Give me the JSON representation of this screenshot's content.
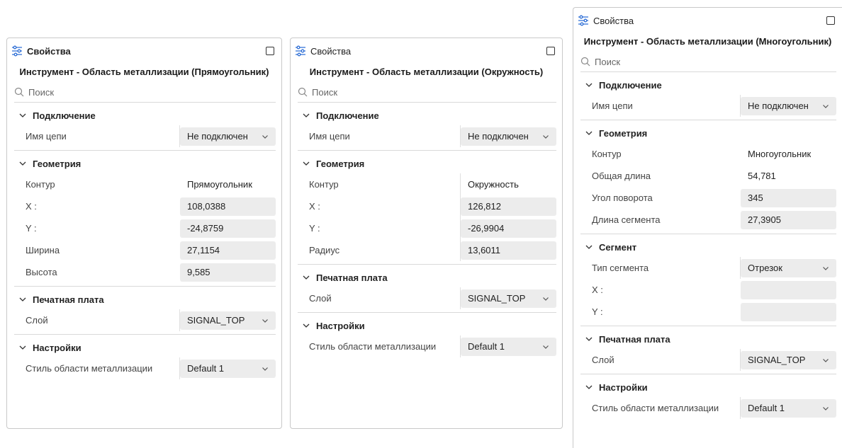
{
  "panels": {
    "rect": {
      "header_title": "Свойства",
      "tool_title": "Инструмент - Область металлизации (Прямоугольник)",
      "search_placeholder": "Поиск",
      "connection": {
        "title": "Подключение",
        "net_label": "Имя цепи",
        "net_value": "Не подключен"
      },
      "geometry": {
        "title": "Геометрия",
        "contour_label": "Контур",
        "contour_value": "Прямоугольник",
        "x_label": "X :",
        "x_value": "108,0388",
        "y_label": "Y :",
        "y_value": "-24,8759",
        "width_label": "Ширина",
        "width_value": "27,1154",
        "height_label": "Высота",
        "height_value": "9,585"
      },
      "pcb": {
        "title": "Печатная плата",
        "layer_label": "Слой",
        "layer_value": "SIGNAL_TOP"
      },
      "settings": {
        "title": "Настройки",
        "style_label": "Стиль области металлизации",
        "style_value": "Default 1"
      }
    },
    "circle": {
      "header_title": "Свойства",
      "tool_title": "Инструмент - Область металлизации (Окружность)",
      "search_placeholder": "Поиск",
      "connection": {
        "title": "Подключение",
        "net_label": "Имя цепи",
        "net_value": "Не подключен"
      },
      "geometry": {
        "title": "Геометрия",
        "contour_label": "Контур",
        "contour_value": "Окружность",
        "x_label": "X :",
        "x_value": "126,812",
        "y_label": "Y :",
        "y_value": "-26,9904",
        "radius_label": "Радиус",
        "radius_value": "13,6011"
      },
      "pcb": {
        "title": "Печатная плата",
        "layer_label": "Слой",
        "layer_value": "SIGNAL_TOP"
      },
      "settings": {
        "title": "Настройки",
        "style_label": "Стиль области металлизации",
        "style_value": "Default 1"
      }
    },
    "poly": {
      "header_title": "Свойства",
      "tool_title": "Инструмент - Область металлизации (Многоугольник)",
      "search_placeholder": "Поиск",
      "connection": {
        "title": "Подключение",
        "net_label": "Имя цепи",
        "net_value": "Не подключен"
      },
      "geometry": {
        "title": "Геометрия",
        "contour_label": "Контур",
        "contour_value": "Многоугольник",
        "total_length_label": "Общая длина",
        "total_length_value": "54,781",
        "rotation_label": "Угол поворота",
        "rotation_value": "345",
        "segment_length_label": "Длина сегмента",
        "segment_length_value": "27,3905"
      },
      "segment": {
        "title": "Сегмент",
        "type_label": "Тип сегмента",
        "type_value": "Отрезок",
        "x_label": "X :",
        "x_value": "",
        "y_label": "Y :",
        "y_value": ""
      },
      "pcb": {
        "title": "Печатная плата",
        "layer_label": "Слой",
        "layer_value": "SIGNAL_TOP"
      },
      "settings": {
        "title": "Настройки",
        "style_label": "Стиль области металлизации",
        "style_value": "Default 1"
      }
    }
  },
  "icons": {
    "properties": "sliders-icon",
    "maximize": "maximize-icon",
    "search": "search-icon",
    "collapse": "chevron-down-icon",
    "dropdown": "chevron-down-icon"
  },
  "colors": {
    "icon_accent": "#2f6fd6",
    "field_bg": "#ececec",
    "border": "#c9c9c9"
  }
}
